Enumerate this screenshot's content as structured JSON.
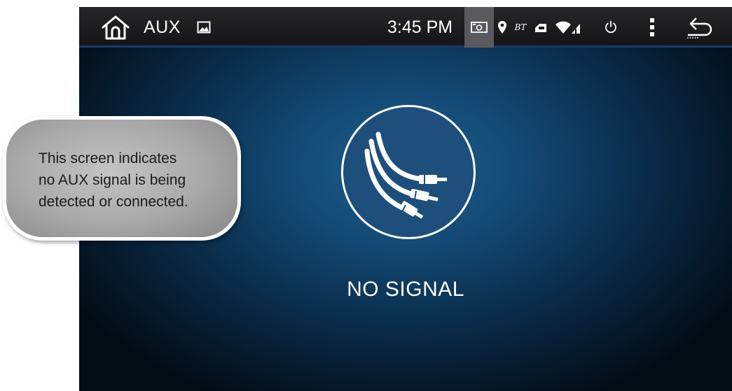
{
  "statusbar": {
    "home_icon": "home-icon",
    "source_label": "AUX",
    "gallery_icon": "image-icon",
    "clock": "3:45 PM",
    "screenshot_icon": "screenshot-icon",
    "location_icon": "location-pin-icon",
    "bluetooth_label": "BT",
    "usb_icon": "usb-icon",
    "wifi_icon": "wifi-icon",
    "cell_icon": "cell-signal-icon",
    "power_icon": "power-icon",
    "menu_icon": "overflow-menu-icon",
    "back_icon": "back-icon"
  },
  "main": {
    "aux_cable_icon": "aux-cable-icon",
    "status_text": "NO SIGNAL"
  },
  "callout": {
    "lines": [
      "This screen indicates",
      "no AUX signal is being",
      "detected or connected."
    ]
  },
  "colors": {
    "background_center": "#1f5f8f",
    "background_edge": "#030b14",
    "statusbar": "#1c1c1e",
    "icon_circle_fill": "#1e4f7c",
    "callout_fill": "#b0b0b0",
    "text": "#ffffff"
  }
}
